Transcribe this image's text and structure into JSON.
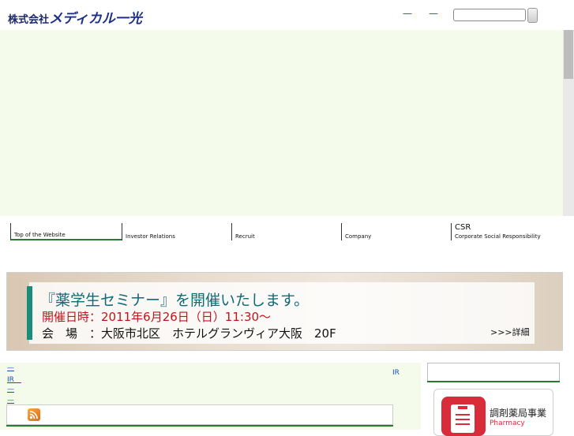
{
  "header": {
    "logo": {
      "prefix": "株式会社",
      "name": "メディカル一光"
    },
    "top_links": [
      "—",
      "—"
    ],
    "search": {
      "value": ""
    }
  },
  "nav": {
    "items": [
      {
        "label": "Top of the Website",
        "active": true
      },
      {
        "label": "Investor Relations"
      },
      {
        "label": "Recruit"
      },
      {
        "label": "Company"
      },
      {
        "label": "Corporate Social Responsibility",
        "heading": "CSR"
      }
    ]
  },
  "banner": {
    "title": "『薬学生セミナー』を開催いたします。",
    "date": "開催日時：2011年6月26日（日）11:30〜",
    "venue": "会　場　：大阪市北区　ホテルグランヴィア大阪　20F",
    "detail_link": ">>>詳細"
  },
  "content": {
    "links": [
      "—",
      "IR　",
      "—",
      "—"
    ],
    "ir_label": "IR"
  },
  "sidebar": {
    "card": {
      "title": "調剤薬局事業",
      "subtitle": "Pharmacy"
    }
  },
  "colors": {
    "accent_green": "#2a7a30",
    "hero_bg": "#f4fbea",
    "banner_teal": "#0f6b77",
    "banner_red": "#c0141c",
    "pharmacy_red": "#d92c3a"
  }
}
